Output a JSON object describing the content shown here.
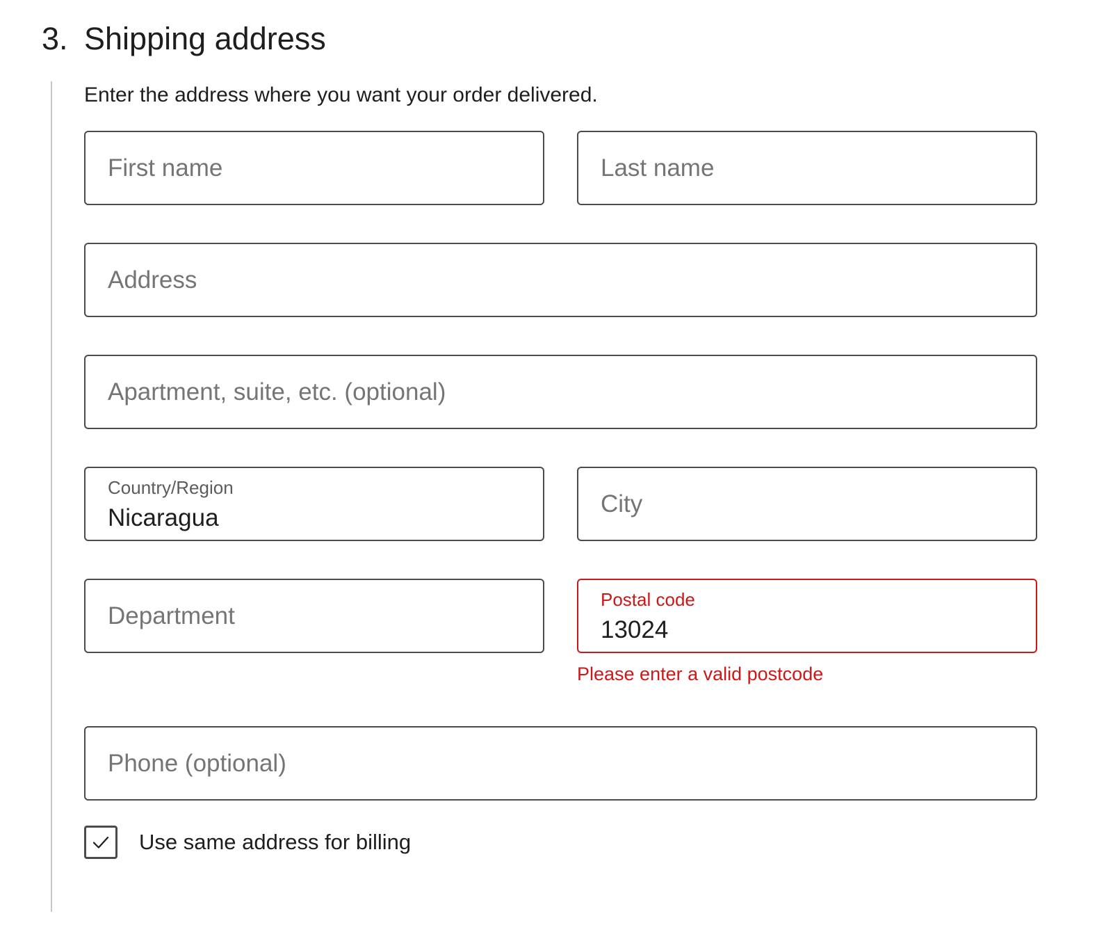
{
  "step": {
    "number": "3.",
    "title": "Shipping address"
  },
  "description": "Enter the address where you want your order delivered.",
  "fields": {
    "first_name": {
      "placeholder": "First name",
      "value": ""
    },
    "last_name": {
      "placeholder": "Last name",
      "value": ""
    },
    "address": {
      "placeholder": "Address",
      "value": ""
    },
    "apartment": {
      "placeholder": "Apartment, suite, etc. (optional)",
      "value": ""
    },
    "country": {
      "label": "Country/Region",
      "value": "Nicaragua"
    },
    "city": {
      "placeholder": "City",
      "value": ""
    },
    "department": {
      "placeholder": "Department",
      "value": ""
    },
    "postal_code": {
      "label": "Postal code",
      "value": "13024",
      "error": "Please enter a valid postcode"
    },
    "phone": {
      "placeholder": "Phone (optional)",
      "value": ""
    }
  },
  "billing_checkbox": {
    "label": "Use same address for billing",
    "checked": true
  },
  "colors": {
    "text": "#1e1e1e",
    "placeholder": "#757575",
    "border": "#4b4b4f",
    "error": "#cc1818",
    "rail": "#c7c7c7"
  }
}
